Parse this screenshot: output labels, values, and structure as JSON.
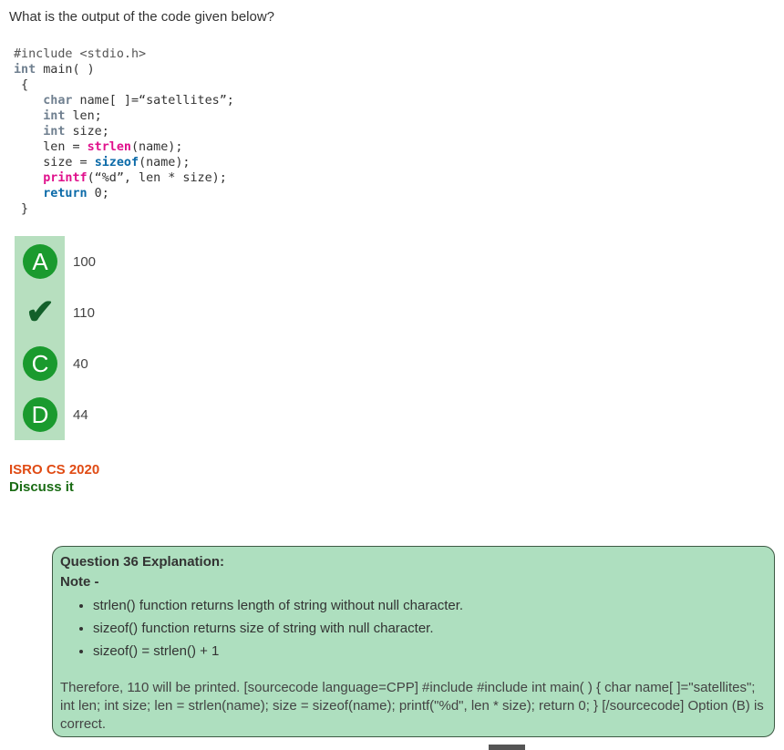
{
  "question": {
    "text": "What is the output of the code given below?"
  },
  "code_lines": [
    {
      "parts": [
        {
          "t": "#include <stdio.h>",
          "c": "c-pre"
        }
      ]
    },
    {
      "parts": [
        {
          "t": "int",
          "c": "c-kw"
        },
        {
          "t": " main( )",
          "c": ""
        }
      ]
    },
    {
      "parts": [
        {
          "t": " {",
          "c": ""
        }
      ]
    },
    {
      "parts": [
        {
          "t": "    ",
          "c": ""
        },
        {
          "t": "char",
          "c": "c-kw"
        },
        {
          "t": " name[ ]=“satellites”;",
          "c": ""
        }
      ]
    },
    {
      "parts": [
        {
          "t": "    ",
          "c": ""
        },
        {
          "t": "int",
          "c": "c-kw"
        },
        {
          "t": " len;",
          "c": ""
        }
      ]
    },
    {
      "parts": [
        {
          "t": "    ",
          "c": ""
        },
        {
          "t": "int",
          "c": "c-kw"
        },
        {
          "t": " size;",
          "c": ""
        }
      ]
    },
    {
      "parts": [
        {
          "t": "    len = ",
          "c": ""
        },
        {
          "t": "strlen",
          "c": "c-fn"
        },
        {
          "t": "(name);",
          "c": ""
        }
      ]
    },
    {
      "parts": [
        {
          "t": "    size = ",
          "c": ""
        },
        {
          "t": "sizeof",
          "c": "c-blue"
        },
        {
          "t": "(name);",
          "c": ""
        }
      ]
    },
    {
      "parts": [
        {
          "t": "    ",
          "c": ""
        },
        {
          "t": "printf",
          "c": "c-fn"
        },
        {
          "t": "(“%d”, len * size);",
          "c": ""
        }
      ]
    },
    {
      "parts": [
        {
          "t": "    ",
          "c": ""
        },
        {
          "t": "return",
          "c": "c-blue"
        },
        {
          "t": " 0;",
          "c": ""
        }
      ]
    },
    {
      "parts": [
        {
          "t": " }",
          "c": ""
        }
      ]
    }
  ],
  "options": [
    {
      "label": "A",
      "text": "100",
      "correct": false
    },
    {
      "label": "✔",
      "text": "110",
      "correct": true
    },
    {
      "label": "C",
      "text": "40",
      "correct": false
    },
    {
      "label": "D",
      "text": "44",
      "correct": false
    }
  ],
  "source": "ISRO CS 2020",
  "discuss": "Discuss it",
  "explanation": {
    "title": "Question 36 Explanation:",
    "note": "Note -",
    "bullets": [
      "strlen() function returns length of string without null character.",
      "sizeof() function returns size of string with null character.",
      "sizeof() = strlen() + 1"
    ],
    "paragraph": "Therefore, 110 will be printed. [sourcecode language=CPP] #include #include int main( ) { char name[ ]=\"satellites\"; int len; int size; len = strlen(name); size = sizeof(name); printf(\"%d\", len * size); return 0; } [/sourcecode] Option (B) is correct."
  },
  "colors": {
    "option_badge": "#1a9a2e",
    "correct_check": "#13602a",
    "source_link": "#e04b14",
    "discuss_link": "#196b13",
    "explanation_bg": "#aedfbf"
  }
}
